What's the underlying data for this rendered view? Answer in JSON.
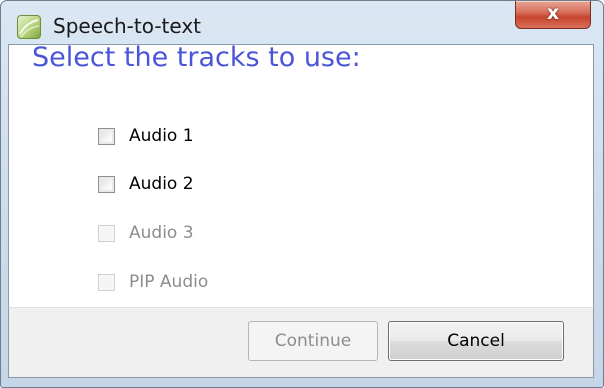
{
  "window": {
    "title": "Speech-to-text",
    "close_label": "x"
  },
  "heading": "Select the tracks to use:",
  "tracks": [
    {
      "label": "Audio 1",
      "checked": false,
      "enabled": true
    },
    {
      "label": "Audio 2",
      "checked": false,
      "enabled": true
    },
    {
      "label": "Audio 3",
      "checked": false,
      "enabled": false
    },
    {
      "label": "PIP Audio",
      "checked": false,
      "enabled": false
    }
  ],
  "buttons": {
    "continue_label": "Continue",
    "continue_enabled": false,
    "cancel_label": "Cancel"
  },
  "colors": {
    "heading": "#4a55d8",
    "close_button": "#c7452d",
    "title_bar": "#cfdeee",
    "disabled_text": "#8d8d8d"
  },
  "icons": {
    "app": "speech-to-text-app-icon",
    "close": "close-icon"
  }
}
